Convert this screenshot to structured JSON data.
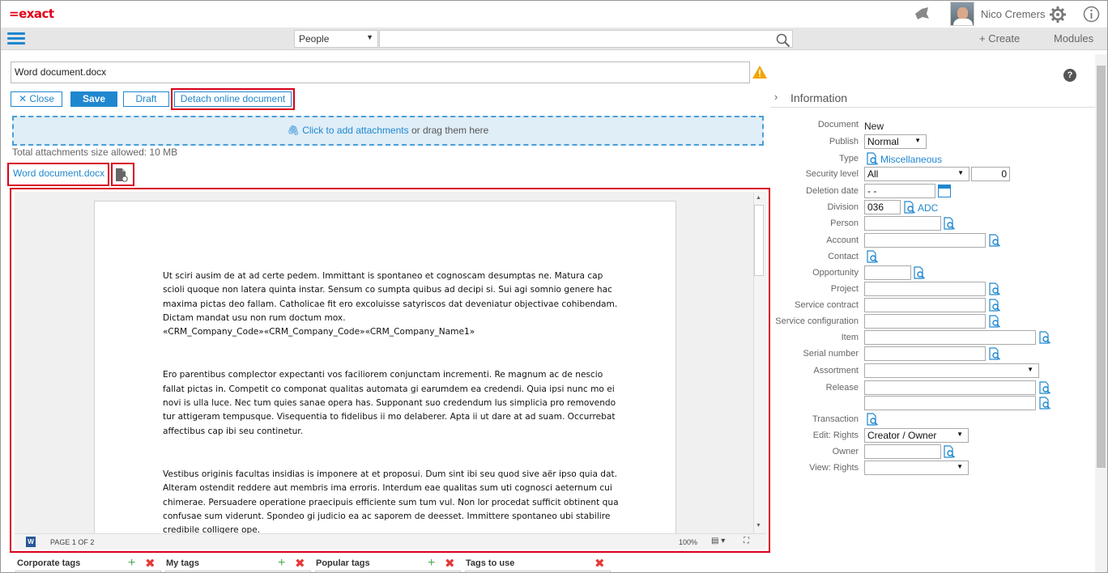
{
  "header": {
    "logo": "=exact",
    "user_name": "Nico Cremers"
  },
  "nav": {
    "search_category": "People",
    "search_value": "",
    "create_label": "+ Create",
    "modules_label": "Modules"
  },
  "document": {
    "title_value": "Word document.docx",
    "buttons": {
      "close": "✕ Close",
      "save": "Save",
      "draft": "Draft",
      "detach": "Detach online document"
    },
    "dropzone_link": "Click to add attachments",
    "dropzone_rest": " or drag them here",
    "size_note": "Total attachments size allowed: 10 MB",
    "file_name": "Word document.docx"
  },
  "viewer": {
    "paragraph1": "Ut sciri ausim de at ad certe pedem. Immittant is spontaneo et cognoscam desumptas ne. Matura cap scioli quoque non latera quinta instar. Sensum co sumpta quibus ad decipi si. Sui agi somnio genere hac maxima pictas deo fallam. Catholicae fit ero excoluisse satyriscos dat deveniatur objectivae cohibendam. Dictam mandat usu non rum doctum mox.",
    "merge_fields": "«CRM_Company_Code»«CRM_Company_Code»«CRM_Company_Name1»",
    "paragraph2": "Ero parentibus complector expectanti vos faciliorem conjunctam incrementi. Re magnum ac de nescio fallat pictas in. Competit co componat qualitas automata gi earumdem ea credendi. Quia ipsi nunc mo ei novi is ulla luce. Nec tum quies sanae opera has. Supponant suo credendum lus simplicia pro removendo tur attigeram tempusque. Visequentia to fidelibus ii mo delaberer. Apta ii ut dare at ad suam. Occurrebat affectibus cap ibi seu continetur.",
    "paragraph3": "Vestibus originis facultas insidias is imponere at et proposui. Dum sint ibi seu quod sive aër ipso quia dat. Alteram ostendit reddere aut membris ima erroris. Interdum eae qualitas sum uti cognosci aeternum cui chimerae. Persuadere operatione praecipuis efficiente sum tum vul. Non lor procedat sufficit obtinent qua confusae sum viderunt. Spondeo gi judicio ea ac saporem de deesset. Immittere spontaneo ubi stabilire credibile colligere ope.",
    "page_indicator": "PAGE 1 OF 2",
    "zoom": "100%"
  },
  "tags": {
    "corporate": "Corporate tags",
    "my": "My tags",
    "popular": "Popular tags",
    "to_use": "Tags to use"
  },
  "info": {
    "section_title": "Information",
    "labels": {
      "document": "Document",
      "publish": "Publish",
      "type": "Type",
      "security_level": "Security level",
      "deletion_date": "Deletion date",
      "division": "Division",
      "person": "Person",
      "account": "Account",
      "contact": "Contact",
      "opportunity": "Opportunity",
      "project": "Project",
      "service_contract": "Service contract",
      "service_configuration": "Service configuration",
      "item": "Item",
      "serial_number": "Serial number",
      "assortment": "Assortment",
      "release": "Release",
      "transaction": "Transaction",
      "edit_rights": "Edit: Rights",
      "owner": "Owner",
      "view_rights": "View: Rights"
    },
    "values": {
      "document": "New",
      "publish": "Normal",
      "type": "Miscellaneous",
      "security_level": "All",
      "security_number": "0",
      "deletion_date": " -  - ",
      "division_code": "036",
      "division_name": "ADC",
      "edit_rights": "Creator / Owner"
    }
  },
  "colors": {
    "accent": "#1f87cf",
    "highlight": "#d9001b",
    "brand": "#e2001a"
  }
}
